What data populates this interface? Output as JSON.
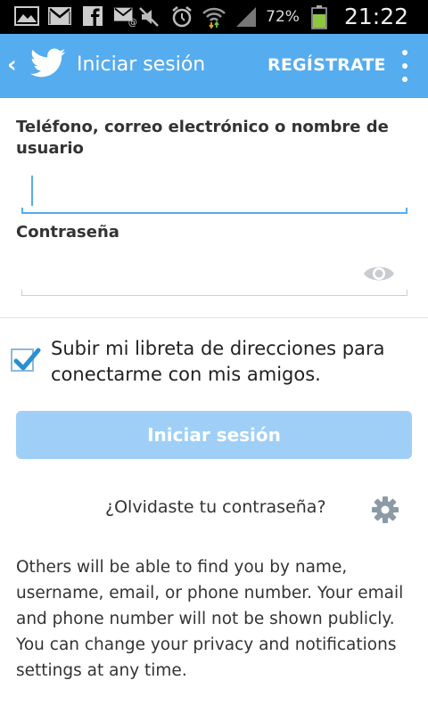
{
  "status_bar": {
    "icons": [
      "gallery-icon",
      "gmail-icon",
      "facebook-icon",
      "email-icon",
      "mute-icon",
      "alarm-icon",
      "wifi-icon",
      "signal-icon",
      "battery-icon"
    ],
    "battery_percent": "72%",
    "time": "21:22"
  },
  "app_bar": {
    "back_glyph": "‹",
    "title": "Iniciar sesión",
    "signup_label": "REGÍSTRATE",
    "color": "#55acee"
  },
  "form": {
    "username_label": "Teléfono, correo electrónico o nombre de usuario",
    "username_value": "",
    "password_label": "Contraseña",
    "password_value": "",
    "checkbox_checked": true,
    "checkbox_label": "Subir mi libreta de direcciones para conectarme con mis amigos.",
    "login_button_label": "Iniciar sesión",
    "login_button_color": "#9fcff6",
    "forgot_password_link": "¿Olvidaste tu contraseña?"
  },
  "info_text": "Others will be able to find you by name, username, email, or phone number. Your email and phone number will not be shown publicly. You can change your privacy and notifications settings at any time."
}
